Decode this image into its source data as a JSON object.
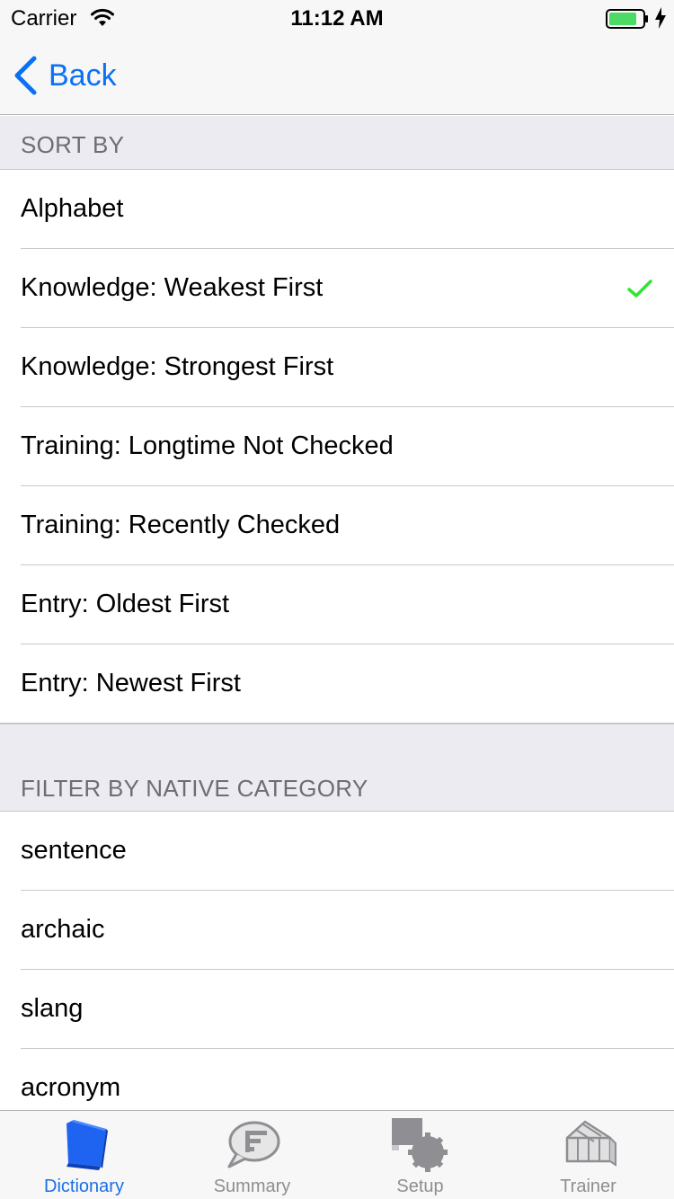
{
  "status_bar": {
    "carrier": "Carrier",
    "time": "11:12 AM",
    "battery_color": "#4cd964"
  },
  "nav": {
    "back_label": "Back",
    "accent_color": "#0b71f4"
  },
  "sections": {
    "sort": {
      "header": "SORT BY",
      "items": [
        {
          "label": "Alphabet",
          "checked": false
        },
        {
          "label": "Knowledge: Weakest First",
          "checked": true
        },
        {
          "label": "Knowledge: Strongest First",
          "checked": false
        },
        {
          "label": "Training: Longtime Not Checked",
          "checked": false
        },
        {
          "label": "Training: Recently Checked",
          "checked": false
        },
        {
          "label": "Entry: Oldest First",
          "checked": false
        },
        {
          "label": "Entry: Newest First",
          "checked": false
        }
      ]
    },
    "filter": {
      "header": "FILTER BY NATIVE CATEGORY",
      "items": [
        {
          "label": "sentence"
        },
        {
          "label": "archaic"
        },
        {
          "label": "slang"
        },
        {
          "label": "acronym"
        }
      ]
    }
  },
  "checkmark_color": "#2ee62e",
  "tabs": [
    {
      "label": "Dictionary",
      "icon": "book-icon",
      "active": true
    },
    {
      "label": "Summary",
      "icon": "speech-bubble-icon",
      "active": false
    },
    {
      "label": "Setup",
      "icon": "gears-icon",
      "active": false
    },
    {
      "label": "Trainer",
      "icon": "greenhouse-icon",
      "active": false
    }
  ]
}
